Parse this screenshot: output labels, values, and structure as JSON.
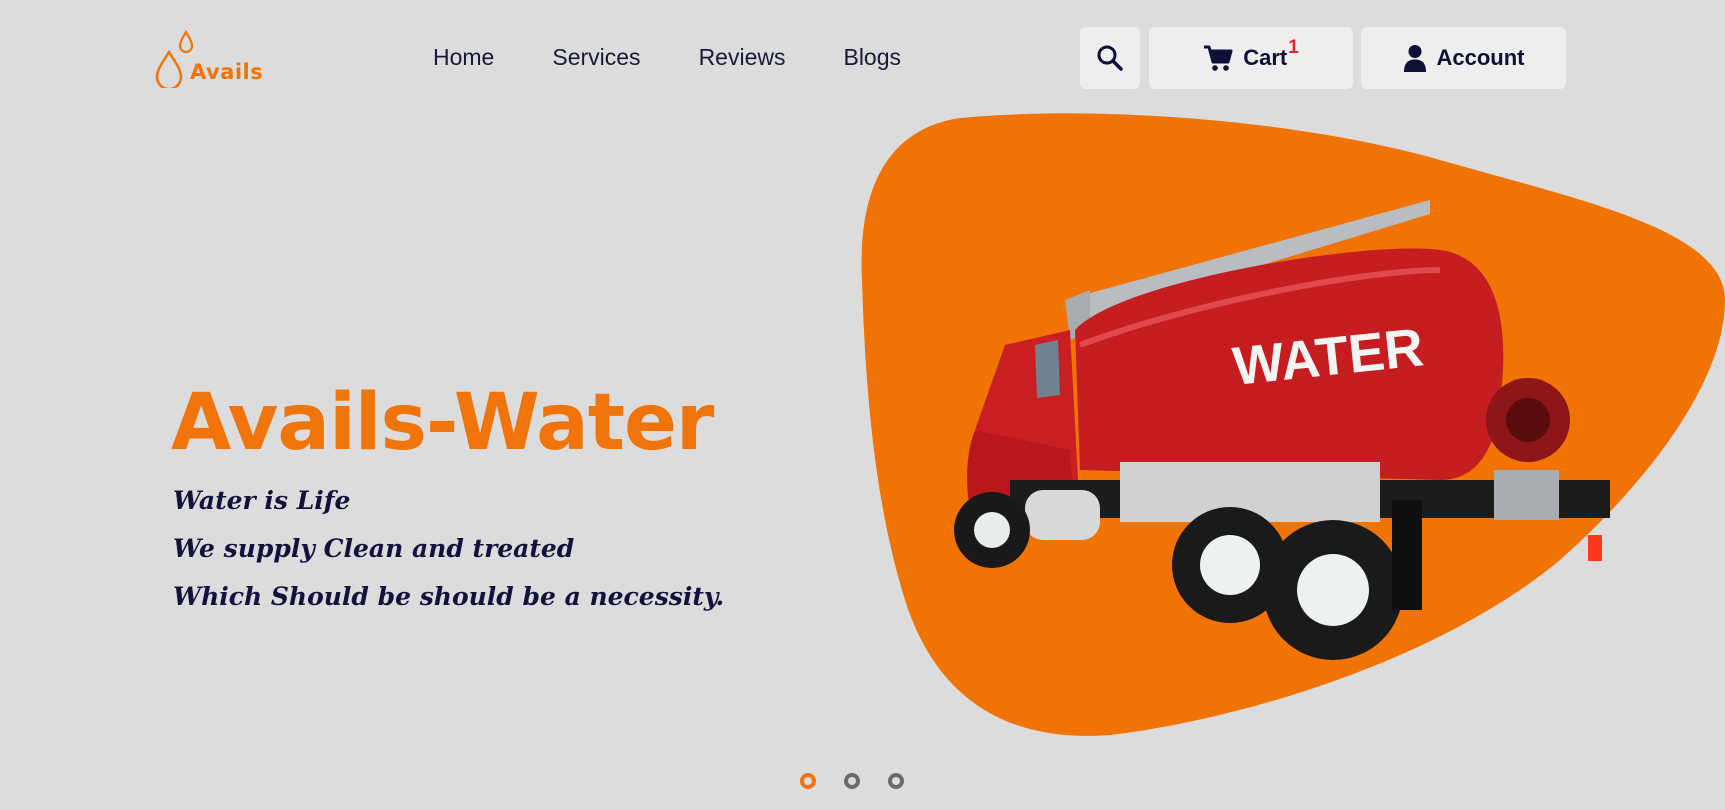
{
  "brand": {
    "name": "Avails",
    "accent": "#f07409",
    "text_dark": "#14123d"
  },
  "nav": {
    "items": [
      "Home",
      "Services",
      "Reviews",
      "Blogs"
    ]
  },
  "header_actions": {
    "search_icon": "search-icon",
    "cart_label": "Cart",
    "cart_count": "1",
    "account_label": "Account"
  },
  "hero": {
    "title": "Avails-Water",
    "lines": [
      "Water is Life",
      "We supply Clean and treated",
      "Which Should be should be a necessity."
    ],
    "truck_label": "WATER"
  },
  "carousel": {
    "slides": 3,
    "active_index": 0
  }
}
